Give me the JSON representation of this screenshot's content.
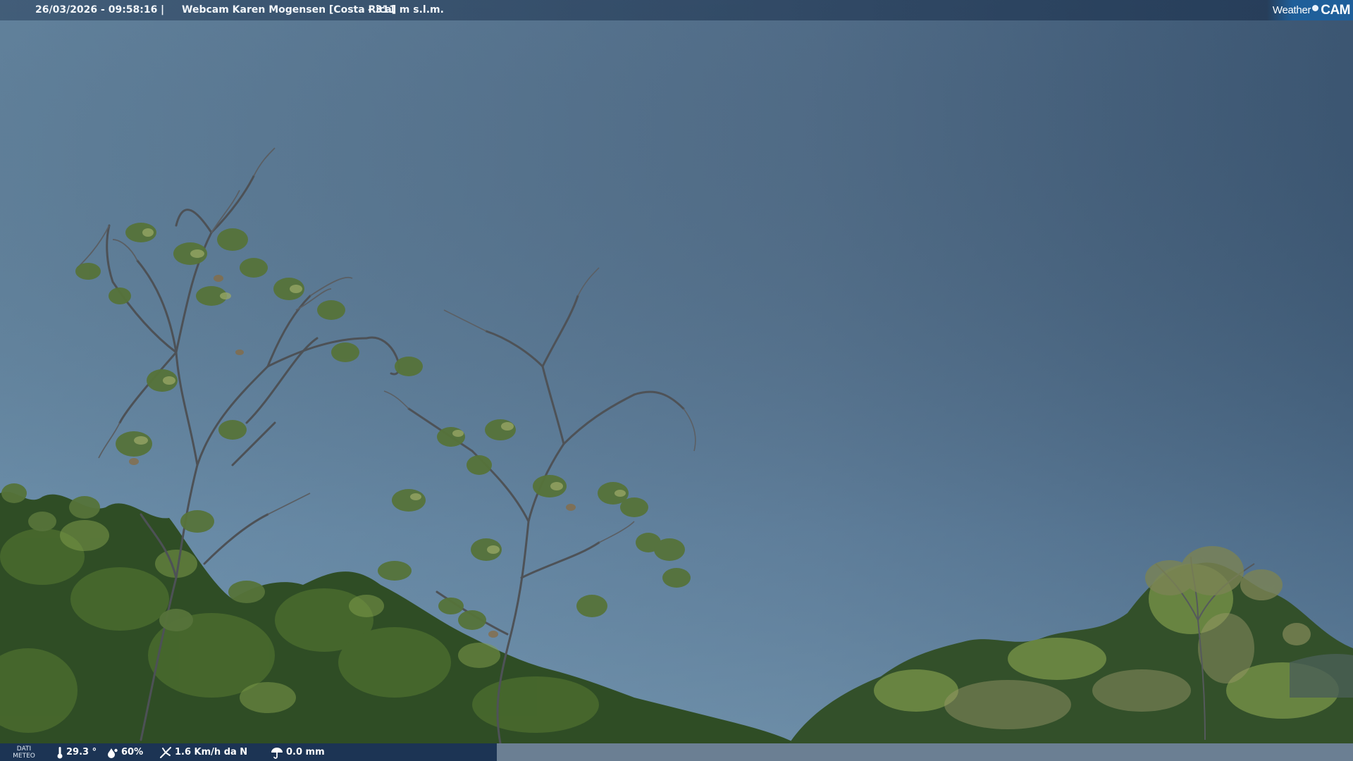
{
  "overlay": {
    "datetime": "26/03/2026 - 09:58:16",
    "separator": "|",
    "title": "Webcam Karen Mogensen [Costa Rica]",
    "elevation": "- 311 m s.l.m.",
    "logo_word": "Weather",
    "logo_cam": "CAM"
  },
  "meteo": {
    "label_line1": "DATI",
    "label_line2": "METEO",
    "temperature": "29.3 °",
    "humidity": "60%",
    "wind": "1.6 Km/h da N",
    "rain": "0.0 mm",
    "icons": [
      "thermometer-icon",
      "humidity-drop-icon",
      "wind-icon",
      "rain-umbrella-icon"
    ]
  },
  "scene": {
    "description_colors": {
      "sky_top_left": "#5c7f9c",
      "sky_right": "#45617f",
      "sky_bottom": "#6f93ac",
      "foliage_dark": "#2d4a24",
      "foliage_light": "#6a8a3c"
    }
  }
}
